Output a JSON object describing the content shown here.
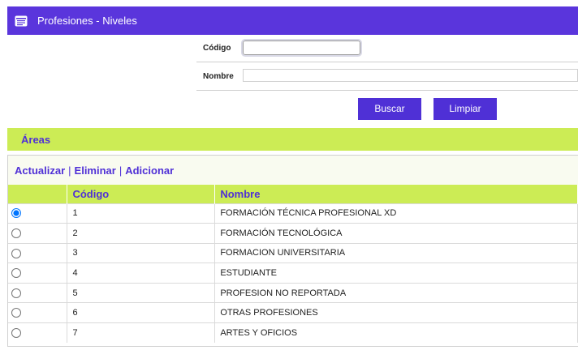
{
  "header": {
    "title": "Profesiones - Niveles",
    "icon": "list-window-icon"
  },
  "form": {
    "codigo_label": "Código",
    "codigo_value": "",
    "nombre_label": "Nombre",
    "nombre_value": ""
  },
  "buttons": {
    "buscar": "Buscar",
    "limpiar": "Limpiar"
  },
  "section": {
    "title": "Áreas"
  },
  "actions": {
    "actualizar": "Actualizar",
    "eliminar": "Eliminar",
    "adicionar": "Adicionar",
    "separator": "|"
  },
  "table": {
    "headers": {
      "select": "",
      "codigo": "Código",
      "nombre": "Nombre"
    },
    "rows": [
      {
        "codigo": "1",
        "nombre": "FORMACIÓN TÉCNICA PROFESIONAL XD",
        "selected": true
      },
      {
        "codigo": "2",
        "nombre": "FORMACIÓN TECNOLÓGICA",
        "selected": false
      },
      {
        "codigo": "3",
        "nombre": "FORMACION UNIVERSITARIA",
        "selected": false
      },
      {
        "codigo": "4",
        "nombre": "ESTUDIANTE",
        "selected": false
      },
      {
        "codigo": "5",
        "nombre": "PROFESION NO REPORTADA",
        "selected": false
      },
      {
        "codigo": "6",
        "nombre": "OTRAS PROFESIONES",
        "selected": false
      },
      {
        "codigo": "7",
        "nombre": "ARTES Y OFICIOS",
        "selected": false
      }
    ]
  },
  "colors": {
    "primary": "#5a35dc",
    "button": "#4f30d6",
    "accent": "#ccec55"
  }
}
